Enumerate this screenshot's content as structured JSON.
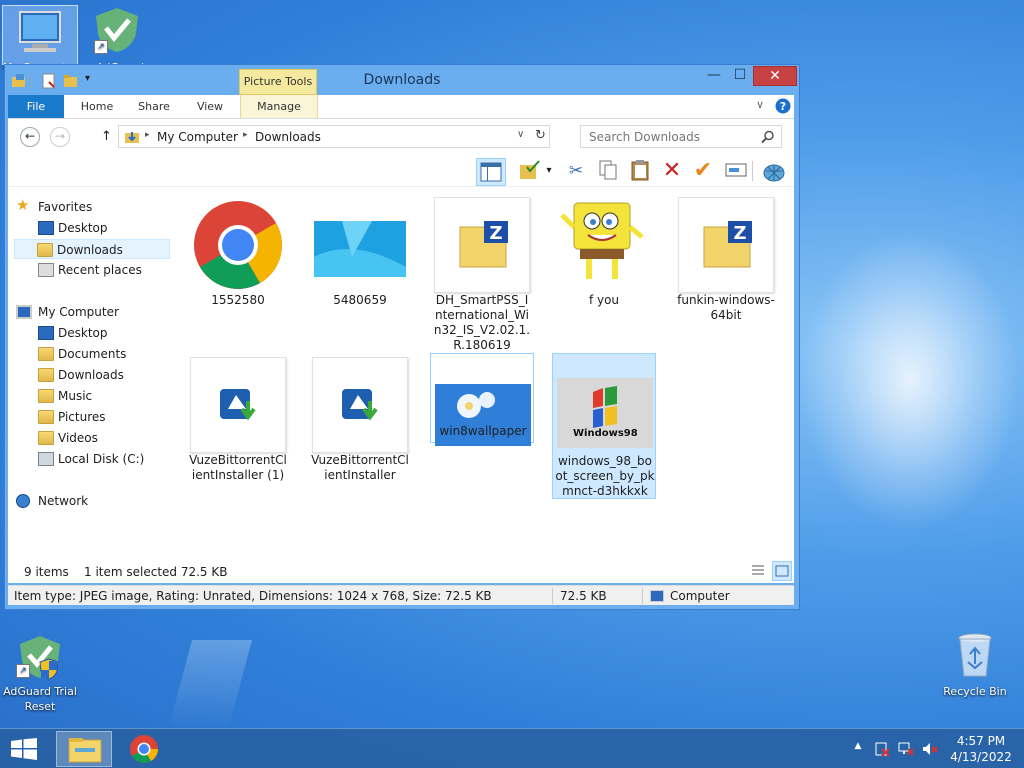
{
  "desktop": {
    "icons": [
      {
        "label": "My Computer"
      },
      {
        "label": "AdGuard"
      },
      {
        "label": "AdGuard Trial Reset"
      },
      {
        "label": "Recycle Bin"
      }
    ]
  },
  "window": {
    "title": "Downloads",
    "picture_tools": "Picture Tools",
    "controls": {
      "minimize": "—",
      "maximize": "☐",
      "close": "✕"
    }
  },
  "ribbon": {
    "tabs": [
      "File",
      "Home",
      "Share",
      "View",
      "Manage"
    ]
  },
  "address": {
    "root": "My Computer",
    "current": "Downloads",
    "search_placeholder": "Search Downloads"
  },
  "nav": {
    "favorites": "Favorites",
    "favorites_items": [
      "Desktop",
      "Downloads",
      "Recent places"
    ],
    "computer": "My Computer",
    "computer_items": [
      "Desktop",
      "Documents",
      "Downloads",
      "Music",
      "Pictures",
      "Videos",
      "Local Disk (C:)"
    ],
    "network": "Network"
  },
  "files": [
    {
      "name": "1552580",
      "kind": "chrome-image"
    },
    {
      "name": "5480659",
      "kind": "win8-image"
    },
    {
      "name": "DH_SmartPSS_International_Win32_IS_V2.02.1.R.180619",
      "kind": "zip-folder"
    },
    {
      "name": "f you",
      "kind": "sponge-image"
    },
    {
      "name": "funkin-windows-64bit",
      "kind": "zip-folder"
    },
    {
      "name": "VuzeBittorrentClientInstaller (1)",
      "kind": "installer"
    },
    {
      "name": "VuzeBittorrentClientInstaller",
      "kind": "installer"
    },
    {
      "name": "win8wallpaper",
      "kind": "flower-image"
    },
    {
      "name": "windows_98_boot_screen_by_pkmnct-d3hkkxk",
      "kind": "win98-image",
      "selected": true
    }
  ],
  "win98_text": "Windows98",
  "status": {
    "count": "9 items",
    "selection": "1 item selected  72.5 KB"
  },
  "details": {
    "info": "Item type: JPEG image, Rating: Unrated, Dimensions: 1024 x 768, Size: 72.5 KB",
    "size": "72.5 KB",
    "location": "Computer"
  },
  "taskbar": {
    "time": "4:57 PM",
    "date": "4/13/2022"
  }
}
